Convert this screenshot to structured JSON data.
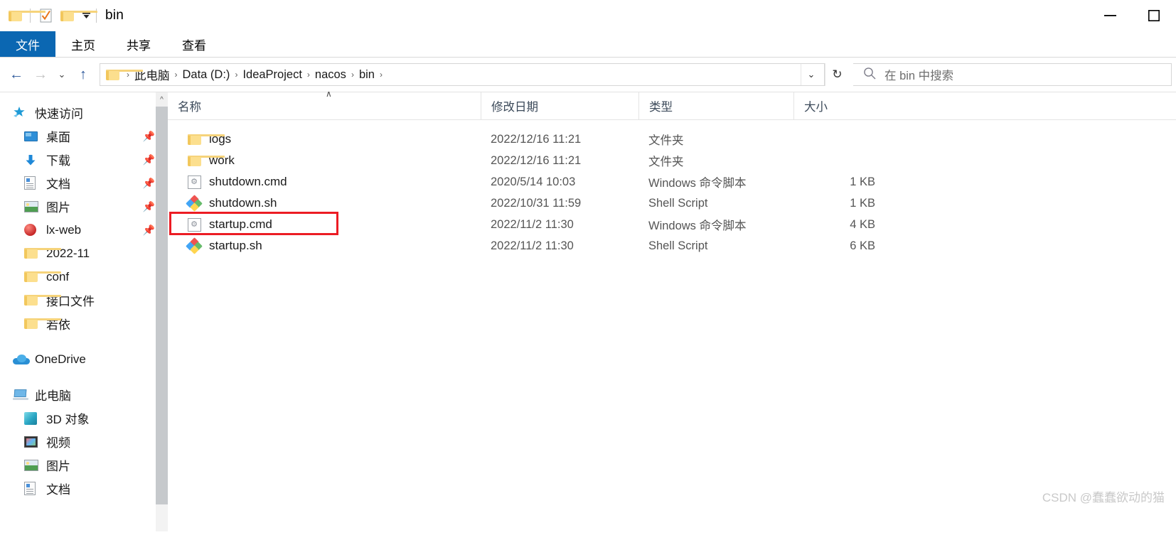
{
  "window": {
    "title": "bin",
    "qat": {
      "folder_icon": "folder-icon",
      "properties_icon": "properties-checkbox-icon",
      "newfolder_icon": "new-folder-icon",
      "customize_icon": "chevron-down-icon"
    },
    "controls": {
      "minimize": "—",
      "maximize": "☐"
    }
  },
  "ribbon": {
    "tabs": [
      {
        "label": "文件",
        "active": true
      },
      {
        "label": "主页",
        "active": false
      },
      {
        "label": "共享",
        "active": false
      },
      {
        "label": "查看",
        "active": false
      }
    ],
    "active_tab_color": "#0b67b2"
  },
  "nav": {
    "back": "←",
    "forward": "→",
    "recent": "⌄",
    "up": "↑",
    "refresh": "↻",
    "address_dropdown": "⌄",
    "breadcrumbs": [
      "此电脑",
      "Data (D:)",
      "IdeaProject",
      "nacos",
      "bin"
    ],
    "separator": "›"
  },
  "search": {
    "icon": "search-icon",
    "placeholder": "在 bin 中搜索"
  },
  "sidebar": {
    "groups": [
      {
        "header": {
          "label": "快速访问",
          "icon": "star-icon"
        },
        "items": [
          {
            "label": "桌面",
            "icon": "desktop-icon",
            "pinned": true
          },
          {
            "label": "下载",
            "icon": "download-icon",
            "pinned": true
          },
          {
            "label": "文档",
            "icon": "documents-icon",
            "pinned": true
          },
          {
            "label": "图片",
            "icon": "pictures-icon",
            "pinned": true
          },
          {
            "label": "lx-web",
            "icon": "ball-icon",
            "pinned": true
          },
          {
            "label": "2022-11",
            "icon": "folder-icon",
            "pinned": false
          },
          {
            "label": "conf",
            "icon": "folder-icon",
            "pinned": false
          },
          {
            "label": "接口文件",
            "icon": "folder-icon",
            "pinned": false
          },
          {
            "label": "若依",
            "icon": "folder-icon",
            "pinned": false
          }
        ]
      },
      {
        "header": {
          "label": "OneDrive",
          "icon": "onedrive-cloud-icon"
        },
        "items": []
      },
      {
        "header": {
          "label": "此电脑",
          "icon": "this-pc-icon"
        },
        "items": [
          {
            "label": "3D 对象",
            "icon": "3d-objects-icon",
            "pinned": false
          },
          {
            "label": "视频",
            "icon": "videos-icon",
            "pinned": false
          },
          {
            "label": "图片",
            "icon": "pictures-icon",
            "pinned": false
          },
          {
            "label": "文档",
            "icon": "documents-icon",
            "pinned": false
          }
        ]
      }
    ]
  },
  "filelist": {
    "columns": [
      {
        "label": "名称",
        "sorted": "asc",
        "caret": "∧"
      },
      {
        "label": "修改日期"
      },
      {
        "label": "类型"
      },
      {
        "label": "大小"
      }
    ],
    "rows": [
      {
        "name": "logs",
        "icon": "folder-icon",
        "date": "2022/12/16 11:21",
        "type": "文件夹",
        "size": ""
      },
      {
        "name": "work",
        "icon": "folder-icon",
        "date": "2022/12/16 11:21",
        "type": "文件夹",
        "size": ""
      },
      {
        "name": "shutdown.cmd",
        "icon": "cmd-script-icon",
        "date": "2020/5/14 10:03",
        "type": "Windows 命令脚本",
        "size": "1 KB"
      },
      {
        "name": "shutdown.sh",
        "icon": "shell-script-icon",
        "date": "2022/10/31 11:59",
        "type": "Shell Script",
        "size": "1 KB"
      },
      {
        "name": "startup.cmd",
        "icon": "cmd-script-icon",
        "date": "2022/11/2 11:30",
        "type": "Windows 命令脚本",
        "size": "4 KB",
        "highlighted": true
      },
      {
        "name": "startup.sh",
        "icon": "shell-script-icon",
        "date": "2022/11/2 11:30",
        "type": "Shell Script",
        "size": "6 KB"
      }
    ]
  },
  "annotation": {
    "target": "startup.cmd",
    "color": "#ec1c24"
  },
  "watermark": {
    "text": "CSDN @蠢蠢欲动的猫"
  }
}
